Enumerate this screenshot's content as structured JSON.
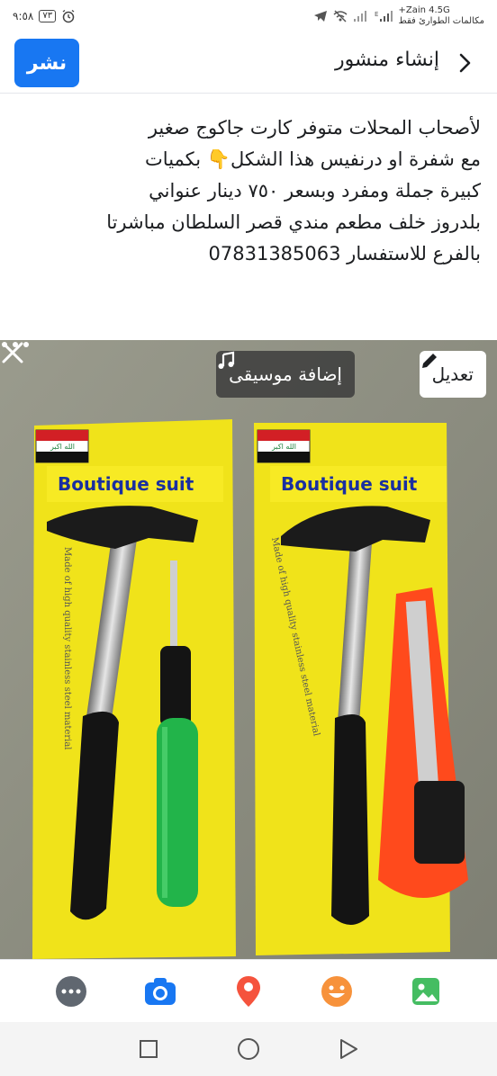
{
  "status_bar": {
    "time": "٩:٥٨",
    "battery": "٧٣",
    "carrier": "Zain 4.5G+",
    "carrier_sub": "مكالمات الطوارئ فقط"
  },
  "header": {
    "title": "إنشاء منشور",
    "post_label": "نشر"
  },
  "post": {
    "lines": [
      "لأصحاب المحلات متوفر كارت جاكوج صغير",
      "مع شفرة او درنفيس هذا الشكل👇 بكميات",
      "كبيرة جملة ومفرد وبسعر ٧٥٠ دينار عنواني",
      "بلدروز خلف مطعم مندي قصر السلطان مباشرتا",
      "بالفرع للاستفسار 07831385063"
    ]
  },
  "photo": {
    "edit_label": "تعديل",
    "music_label": "إضافة موسيقى",
    "card_brand": "Boutique suit",
    "card_side_text": "Made of high quality stainless steel material"
  },
  "toolbar": {
    "icons": [
      "more-icon",
      "camera-icon",
      "location-icon",
      "emoji-icon",
      "photo-icon"
    ]
  },
  "colors": {
    "accent": "#1877f2",
    "card_yellow": "#f0e31a"
  }
}
